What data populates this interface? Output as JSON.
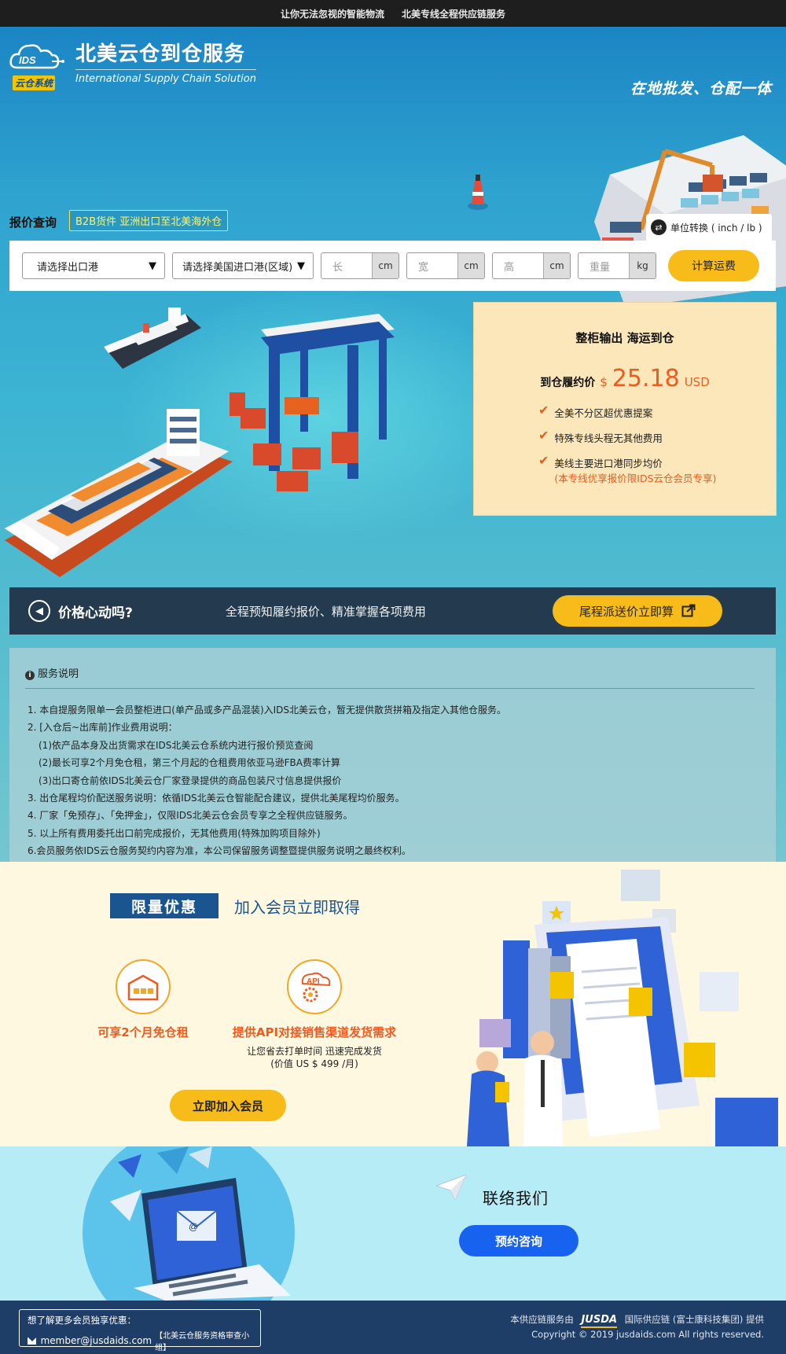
{
  "topbar": {
    "left": "让你无法忽视的智能物流",
    "right": "北美专线全程供应链服务"
  },
  "logo": {
    "mark": "IDS",
    "tag": "云仓系统",
    "cn": "北美云仓到仓服务",
    "en": "International Supply Chain Solution"
  },
  "slogan": "在地批发、仓配一体",
  "quote": {
    "label": "报价查询",
    "tag": "B2B货件  亚洲出口至北美海外仓",
    "unit_toggle": "单位转换 ( inch / lb )",
    "origin_port": "请选择出口港",
    "dest_port": "请选择美国进口港(区域)",
    "length": {
      "placeholder": "长",
      "unit": "cm"
    },
    "width": {
      "placeholder": "宽",
      "unit": "cm"
    },
    "height": {
      "placeholder": "高",
      "unit": "cm"
    },
    "weight": {
      "placeholder": "重量",
      "unit": "kg"
    },
    "calc_button": "计算运费"
  },
  "price_card": {
    "title": "整柜输出 海运到仓",
    "label": "到仓履约价",
    "currency_symbol": "$",
    "value": "25.18",
    "unit": "USD",
    "features": [
      {
        "text": "全美不分区超优惠提案",
        "note": ""
      },
      {
        "text": "特殊专线头程无其他费用",
        "note": ""
      },
      {
        "text": "美线主要进口港同步均价",
        "note": "(本专线优享报价限IDS云仓会员专享)"
      }
    ]
  },
  "banner": {
    "title": "价格心动吗?",
    "subtitle": "全程预知履约报价、精准掌握各项费用",
    "button": "尾程派送价立即算"
  },
  "service": {
    "heading": "服务说明",
    "items": [
      {
        "text": "1. 本自提服务限单一会员整柜进口(单产品或多产品混装)入IDS北美云仓，暂无提供散货拼箱及指定入其他仓服务。",
        "sub": false
      },
      {
        "text": "2. [入仓后~出库前]作业费用说明：",
        "sub": false
      },
      {
        "text": "(1)依产品本身及出货需求在IDS北美云仓系统内进行报价预览查阅",
        "sub": true
      },
      {
        "text": "(2)最长可享2个月免仓租，第三个月起的仓租费用依亚马逊FBA费率计算",
        "sub": true
      },
      {
        "text": "(3)出口寄仓前依IDS北美云仓厂家登录提供的商品包装尺寸信息提供报价",
        "sub": true
      },
      {
        "text": "3. 出仓尾程均价配送服务说明：依循IDS北美云仓智能配合建议，提供北美尾程均价服务。",
        "sub": false
      },
      {
        "text": "4. 厂家「免预存」、「免押金」，仅限IDS北美云仓会员专享之全程供应链服务。",
        "sub": false
      },
      {
        "text": "5. 以上所有费用委托出口前完成报价，无其他费用(特殊加购项目除外)",
        "sub": false
      },
      {
        "text": "6.会员服务依IDS云仓服务契约内容为准，本公司保留服务调整暨提供服务说明之最终权利。",
        "sub": false
      }
    ]
  },
  "member": {
    "badge": "限量优惠",
    "headline": "加入会员立即取得",
    "benefit1": {
      "title": "可享2个月免仓租",
      "icon": "warehouse-icon"
    },
    "benefit2": {
      "title": "提供API对接销售渠道发货需求",
      "icon_label": "API",
      "desc1": "让您省去打单时间  迅速完成发货",
      "desc2": "(价值 US $ 499 /月)"
    },
    "join_button": "立即加入会员"
  },
  "contact": {
    "title": "联络我们",
    "button": "预约咨询"
  },
  "footer": {
    "box_title": "想了解更多会员独享优惠：",
    "email": "member@jusdaids.com",
    "group": "【北美云仓服务资格审查小组】",
    "provider_prefix": "本供应链服务由",
    "brand": "JUSDA",
    "provider_suffix": "国际供应链 (富士康科技集团) 提供",
    "copyright": "Copyright © 2019 jusdaids.com All rights reserved."
  },
  "colors": {
    "accent_yellow": "#f7bb1a",
    "price_orange": "#f05a1e",
    "navy": "#1a5590",
    "banner_dark": "#243b4f",
    "contact_blue": "#1862f0"
  }
}
